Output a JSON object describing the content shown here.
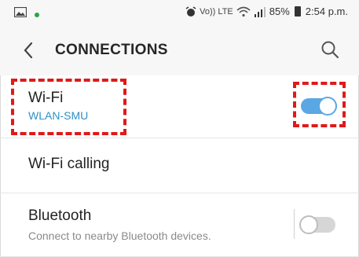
{
  "status_bar": {
    "icons": [
      "gallery-icon",
      "notification-dot-icon",
      "alarm-icon",
      "volte-icon",
      "wifi-icon",
      "signal-icon",
      "battery-icon"
    ],
    "volte_text": "Vo)) LTE",
    "battery": "85%",
    "time": "2:54 p.m."
  },
  "header": {
    "title": "CONNECTIONS",
    "back_icon": "chevron-left-icon",
    "search_icon": "search-icon"
  },
  "settings": [
    {
      "title": "Wi-Fi",
      "subtitle": "WLAN-SMU",
      "toggle": "on"
    },
    {
      "title": "Wi-Fi calling"
    },
    {
      "title": "Bluetooth",
      "subtitle": "Connect to nearby Bluetooth devices.",
      "toggle": "off"
    }
  ],
  "colors": {
    "accent": "#5aa7e3",
    "wifi_subtitle": "#2d90c7",
    "annotation": "#e01919",
    "header_bg": "#f7f7f7"
  }
}
